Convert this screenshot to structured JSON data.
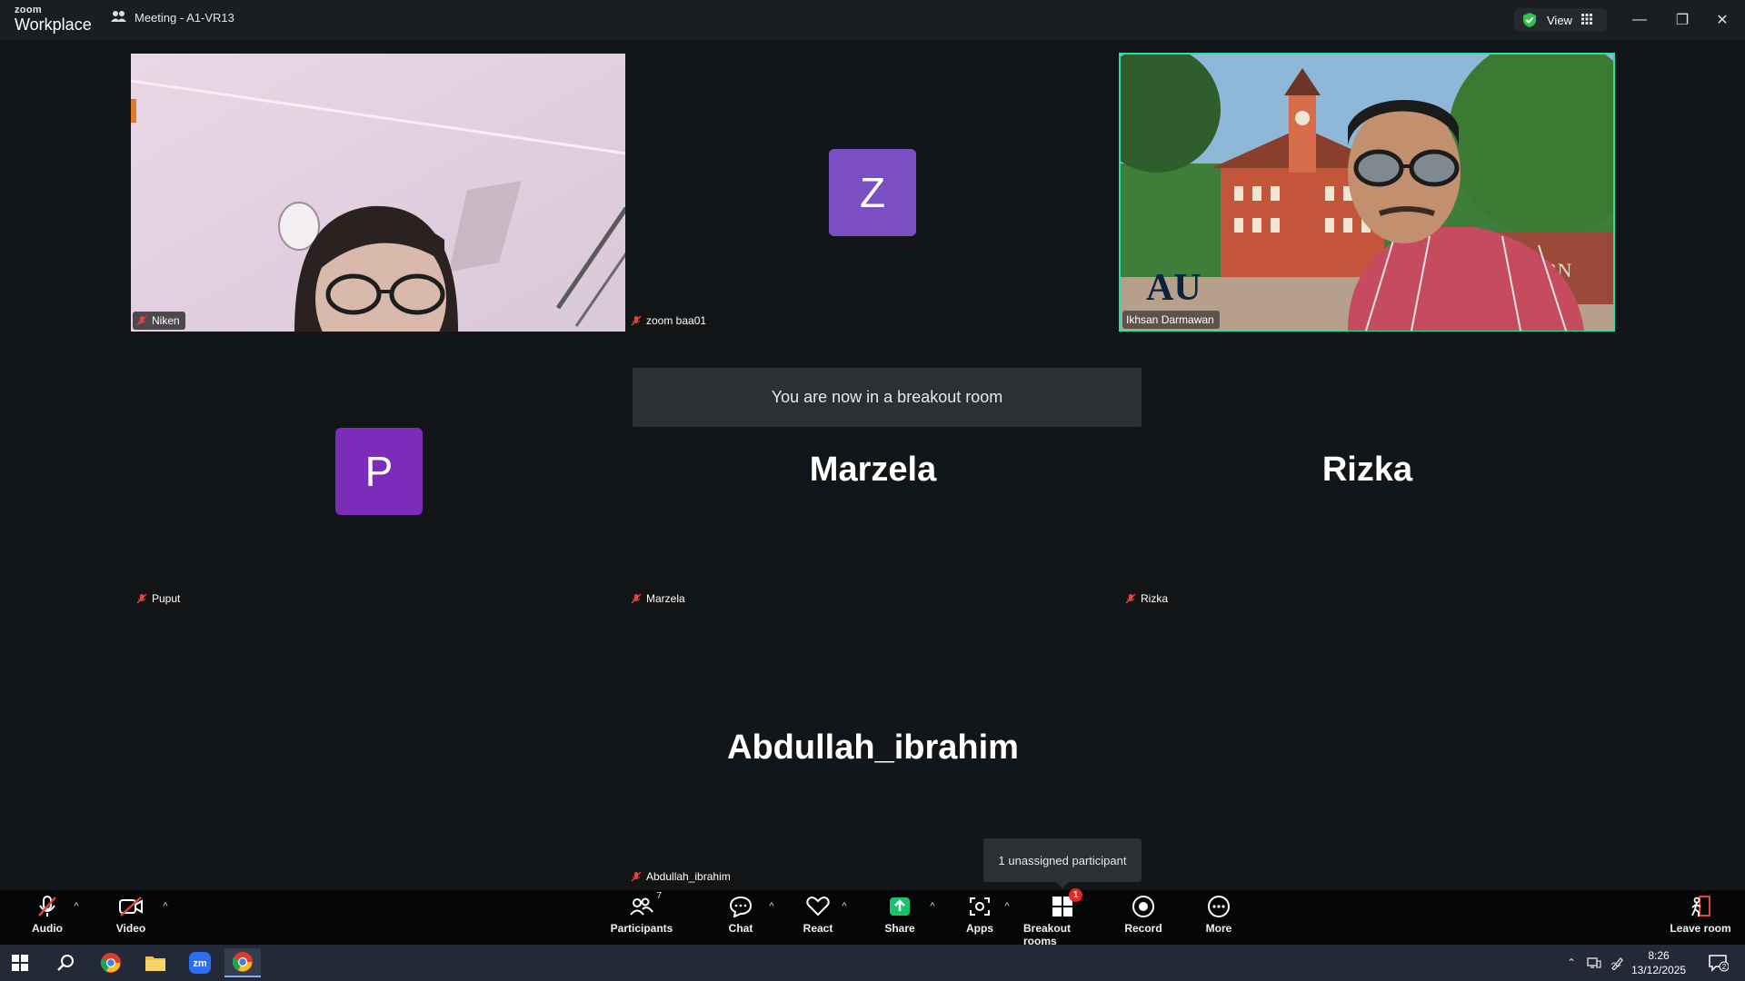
{
  "titlebar": {
    "brand_line1": "zoom",
    "brand_line2": "Workplace",
    "meeting_title": "Meeting - A1-VR13",
    "view_label": "View",
    "minimize": "—",
    "restore": "❐",
    "close": "✕"
  },
  "tiles": {
    "niken": {
      "name": "Niken"
    },
    "zoom_baa01": {
      "name": "zoom baa01",
      "initial": "Z"
    },
    "ikhsan": {
      "name": "Ikhsan Darmawan"
    },
    "puput": {
      "name": "Puput",
      "initial": "P"
    },
    "marzela": {
      "name": "Marzela",
      "display": "Marzela"
    },
    "rizka": {
      "name": "Rizka",
      "display": "Rizka"
    },
    "abdullah": {
      "name": "Abdullah_ibrahim",
      "display": "Abdullah_ibrahim"
    }
  },
  "banner": {
    "text": "You are now in a breakout room"
  },
  "tooltip": {
    "text": "1 unassigned participant"
  },
  "toolbar": {
    "audio": "Audio",
    "video": "Video",
    "participants": "Participants",
    "participants_count": "7",
    "chat": "Chat",
    "react": "React",
    "share": "Share",
    "apps": "Apps",
    "breakout": "Breakout rooms",
    "breakout_badge": "1",
    "record": "Record",
    "more": "More",
    "leave": "Leave room"
  },
  "taskbar": {
    "time": "8:26",
    "date": "13/12/2025",
    "notifications": "2"
  },
  "colors": {
    "accent_green": "#2ddf9c",
    "avatar_z": "#7b4fc4",
    "avatar_p": "#7b2cb8",
    "share_green": "#19c36d",
    "muted_red": "#e0443a"
  }
}
